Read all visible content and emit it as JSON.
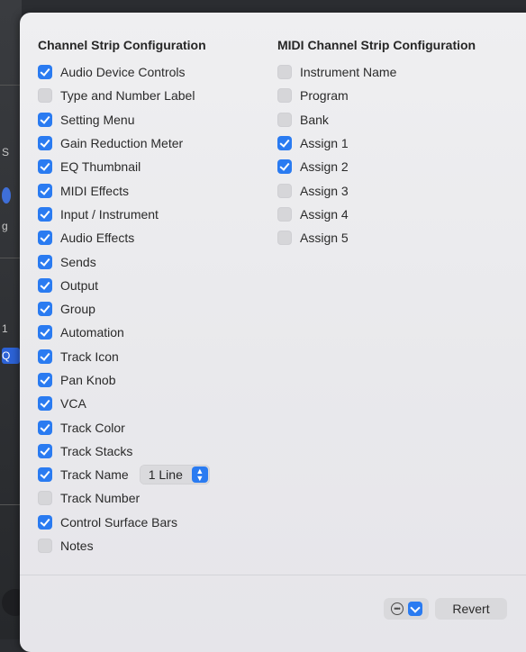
{
  "left_column": {
    "title": "Channel Strip Configuration",
    "items": [
      {
        "label": "Audio Device Controls",
        "checked": true
      },
      {
        "label": "Type and Number Label",
        "checked": false
      },
      {
        "label": "Setting Menu",
        "checked": true
      },
      {
        "label": "Gain Reduction Meter",
        "checked": true
      },
      {
        "label": "EQ Thumbnail",
        "checked": true
      },
      {
        "label": "MIDI Effects",
        "checked": true
      },
      {
        "label": "Input / Instrument",
        "checked": true
      },
      {
        "label": "Audio Effects",
        "checked": true
      },
      {
        "label": "Sends",
        "checked": true
      },
      {
        "label": "Output",
        "checked": true
      },
      {
        "label": "Group",
        "checked": true
      },
      {
        "label": "Automation",
        "checked": true
      },
      {
        "label": "Track Icon",
        "checked": true
      },
      {
        "label": "Pan Knob",
        "checked": true
      },
      {
        "label": "VCA",
        "checked": true
      },
      {
        "label": "Track Color",
        "checked": true
      },
      {
        "label": "Track Stacks",
        "checked": true
      },
      {
        "label": "Track Name",
        "checked": true
      },
      {
        "label": "Track Number",
        "checked": false
      },
      {
        "label": "Control Surface Bars",
        "checked": true
      },
      {
        "label": "Notes",
        "checked": false
      }
    ],
    "track_name_select": {
      "value": "1 Line"
    }
  },
  "right_column": {
    "title": "MIDI Channel Strip Configuration",
    "items": [
      {
        "label": "Instrument Name",
        "checked": false
      },
      {
        "label": "Program",
        "checked": false
      },
      {
        "label": "Bank",
        "checked": false
      },
      {
        "label": "Assign 1",
        "checked": true
      },
      {
        "label": "Assign 2",
        "checked": true
      },
      {
        "label": "Assign 3",
        "checked": false
      },
      {
        "label": "Assign 4",
        "checked": false
      },
      {
        "label": "Assign 5",
        "checked": false
      }
    ]
  },
  "footer": {
    "options_icon": "ellipsis-circle-icon",
    "dropdown_icon": "chevron-down-icon",
    "revert_label": "Revert"
  },
  "background_fragments": [
    "S",
    "g",
    "1",
    "Q"
  ],
  "colors": {
    "accent": "#2a7bf1",
    "panel": "#ececef",
    "text": "#2a2a2a"
  }
}
